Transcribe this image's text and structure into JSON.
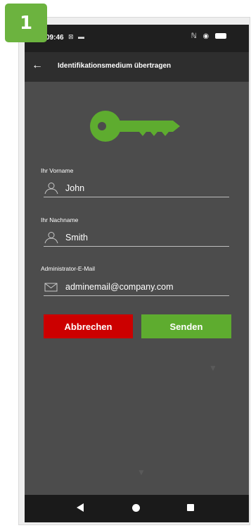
{
  "step_badge": "1",
  "status_bar": {
    "time": "09:46",
    "left_icons_text": "⊠ ▬",
    "right_icons_text": "ℕ ◉"
  },
  "app_bar": {
    "back_icon": "arrow-left-icon",
    "title": "Identifikationsmedium übertragen"
  },
  "hero_icon": "key-icon",
  "form": {
    "first_name": {
      "label": "Ihr Vorname",
      "value": "John",
      "icon": "person-icon"
    },
    "last_name": {
      "label": "Ihr Nachname",
      "value": "Smith",
      "icon": "person-icon"
    },
    "admin_email": {
      "label": "Administrator-E-Mail",
      "value": "adminemail@company.com",
      "icon": "envelope-icon"
    }
  },
  "buttons": {
    "cancel_label": "Abbrechen",
    "send_label": "Senden"
  },
  "colors": {
    "accent_green": "#5eac2f",
    "cancel_red": "#cc0000",
    "badge_green": "#6cb33f",
    "screen_bg": "#4c4c4c"
  },
  "nav_bar": {
    "back_icon": "nav-back-icon",
    "home_icon": "nav-home-icon",
    "recent_icon": "nav-recent-apps-icon"
  }
}
